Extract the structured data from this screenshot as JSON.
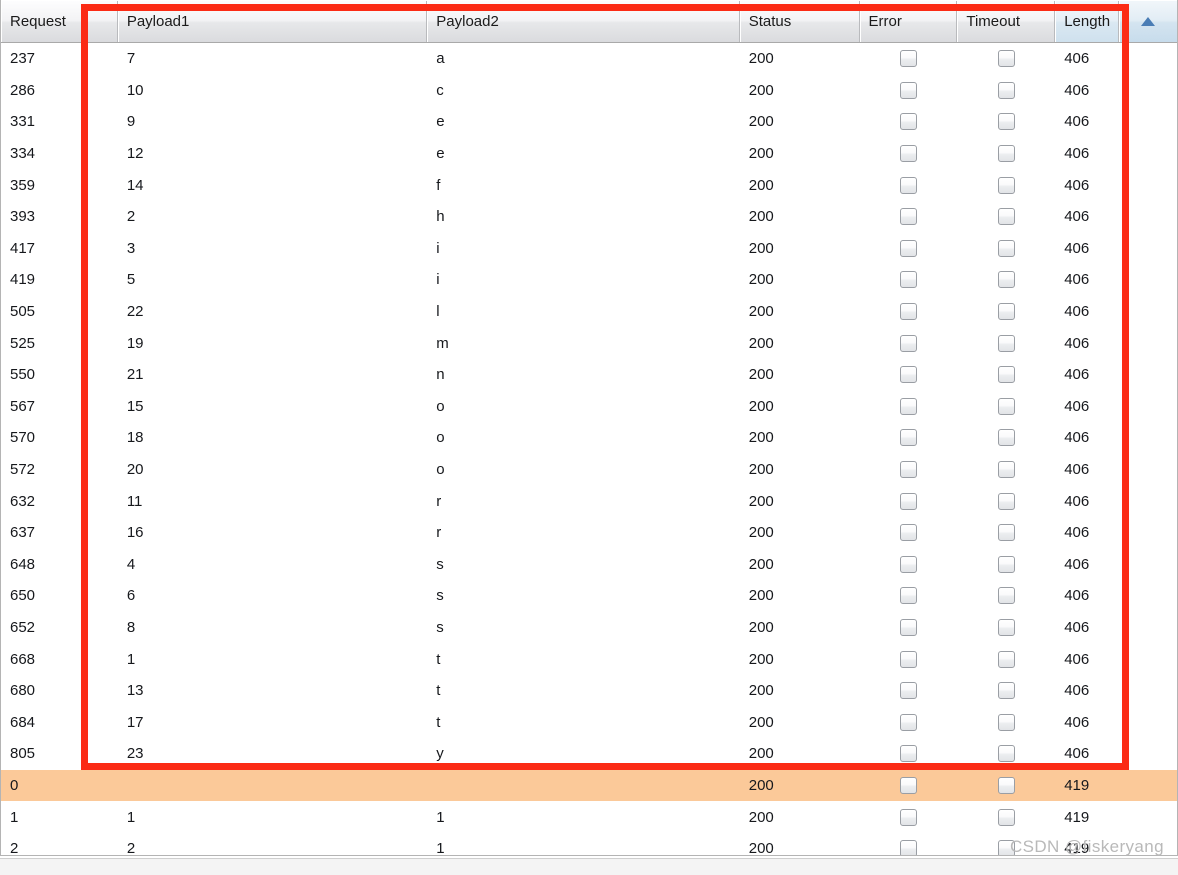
{
  "table": {
    "name": "intruder-attack-results",
    "columns": [
      {
        "key": "request",
        "label": "Request",
        "sorted": false
      },
      {
        "key": "payload1",
        "label": "Payload1",
        "sorted": false
      },
      {
        "key": "payload2",
        "label": "Payload2",
        "sorted": false
      },
      {
        "key": "status",
        "label": "Status",
        "sorted": false
      },
      {
        "key": "error",
        "label": "Error",
        "sorted": false
      },
      {
        "key": "timeout",
        "label": "Timeout",
        "sorted": false
      },
      {
        "key": "length",
        "label": "Length",
        "sorted": true
      }
    ],
    "sort": {
      "column": "Length",
      "direction": "ascending",
      "icon": "triangle-up-icon"
    },
    "rows": [
      {
        "request": "237",
        "payload1": "7",
        "payload2": "a",
        "status": "200",
        "error": false,
        "timeout": false,
        "length": "406",
        "highlight": false
      },
      {
        "request": "286",
        "payload1": "10",
        "payload2": "c",
        "status": "200",
        "error": false,
        "timeout": false,
        "length": "406",
        "highlight": false
      },
      {
        "request": "331",
        "payload1": "9",
        "payload2": "e",
        "status": "200",
        "error": false,
        "timeout": false,
        "length": "406",
        "highlight": false
      },
      {
        "request": "334",
        "payload1": "12",
        "payload2": "e",
        "status": "200",
        "error": false,
        "timeout": false,
        "length": "406",
        "highlight": false
      },
      {
        "request": "359",
        "payload1": "14",
        "payload2": "f",
        "status": "200",
        "error": false,
        "timeout": false,
        "length": "406",
        "highlight": false
      },
      {
        "request": "393",
        "payload1": "2",
        "payload2": "h",
        "status": "200",
        "error": false,
        "timeout": false,
        "length": "406",
        "highlight": false
      },
      {
        "request": "417",
        "payload1": "3",
        "payload2": "i",
        "status": "200",
        "error": false,
        "timeout": false,
        "length": "406",
        "highlight": false
      },
      {
        "request": "419",
        "payload1": "5",
        "payload2": "i",
        "status": "200",
        "error": false,
        "timeout": false,
        "length": "406",
        "highlight": false
      },
      {
        "request": "505",
        "payload1": "22",
        "payload2": "l",
        "status": "200",
        "error": false,
        "timeout": false,
        "length": "406",
        "highlight": false
      },
      {
        "request": "525",
        "payload1": "19",
        "payload2": "m",
        "status": "200",
        "error": false,
        "timeout": false,
        "length": "406",
        "highlight": false
      },
      {
        "request": "550",
        "payload1": "21",
        "payload2": "n",
        "status": "200",
        "error": false,
        "timeout": false,
        "length": "406",
        "highlight": false
      },
      {
        "request": "567",
        "payload1": "15",
        "payload2": "o",
        "status": "200",
        "error": false,
        "timeout": false,
        "length": "406",
        "highlight": false
      },
      {
        "request": "570",
        "payload1": "18",
        "payload2": "o",
        "status": "200",
        "error": false,
        "timeout": false,
        "length": "406",
        "highlight": false
      },
      {
        "request": "572",
        "payload1": "20",
        "payload2": "o",
        "status": "200",
        "error": false,
        "timeout": false,
        "length": "406",
        "highlight": false
      },
      {
        "request": "632",
        "payload1": "11",
        "payload2": "r",
        "status": "200",
        "error": false,
        "timeout": false,
        "length": "406",
        "highlight": false
      },
      {
        "request": "637",
        "payload1": "16",
        "payload2": "r",
        "status": "200",
        "error": false,
        "timeout": false,
        "length": "406",
        "highlight": false
      },
      {
        "request": "648",
        "payload1": "4",
        "payload2": "s",
        "status": "200",
        "error": false,
        "timeout": false,
        "length": "406",
        "highlight": false
      },
      {
        "request": "650",
        "payload1": "6",
        "payload2": "s",
        "status": "200",
        "error": false,
        "timeout": false,
        "length": "406",
        "highlight": false
      },
      {
        "request": "652",
        "payload1": "8",
        "payload2": "s",
        "status": "200",
        "error": false,
        "timeout": false,
        "length": "406",
        "highlight": false
      },
      {
        "request": "668",
        "payload1": "1",
        "payload2": "t",
        "status": "200",
        "error": false,
        "timeout": false,
        "length": "406",
        "highlight": false
      },
      {
        "request": "680",
        "payload1": "13",
        "payload2": "t",
        "status": "200",
        "error": false,
        "timeout": false,
        "length": "406",
        "highlight": false
      },
      {
        "request": "684",
        "payload1": "17",
        "payload2": "t",
        "status": "200",
        "error": false,
        "timeout": false,
        "length": "406",
        "highlight": false
      },
      {
        "request": "805",
        "payload1": "23",
        "payload2": "y",
        "status": "200",
        "error": false,
        "timeout": false,
        "length": "406",
        "highlight": false
      },
      {
        "request": "0",
        "payload1": "",
        "payload2": "",
        "status": "200",
        "error": false,
        "timeout": false,
        "length": "419",
        "highlight": true
      },
      {
        "request": "1",
        "payload1": "1",
        "payload2": "1",
        "status": "200",
        "error": false,
        "timeout": false,
        "length": "419",
        "highlight": false
      },
      {
        "request": "2",
        "payload1": "2",
        "payload2": "1",
        "status": "200",
        "error": false,
        "timeout": false,
        "length": "419",
        "highlight": false
      }
    ]
  },
  "annotation": {
    "name": "red-highlight-rectangle",
    "color": "#fb2b15"
  },
  "watermark": {
    "text": "CSDN @fiskeryang",
    "color": "#b9b9b9"
  },
  "colors": {
    "highlight_row": "#fbc999",
    "sorted_header": "#cfe1ee",
    "sort_arrow": "#4a7db5"
  }
}
